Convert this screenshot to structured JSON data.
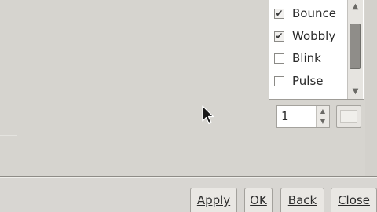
{
  "effects": {
    "items": [
      {
        "label": "Bounce",
        "checked": true
      },
      {
        "label": "Wobbly",
        "checked": true
      },
      {
        "label": "Blink",
        "checked": false
      },
      {
        "label": "Pulse",
        "checked": false
      }
    ]
  },
  "spin": {
    "value": "1"
  },
  "icons": {
    "check": "✔",
    "scroll_up": "▲",
    "scroll_down": "▼",
    "spin_up": "▲",
    "spin_down": "▼"
  },
  "buttons": {
    "apply": "Apply",
    "ok": "OK",
    "back": "Back",
    "close": "Close"
  }
}
